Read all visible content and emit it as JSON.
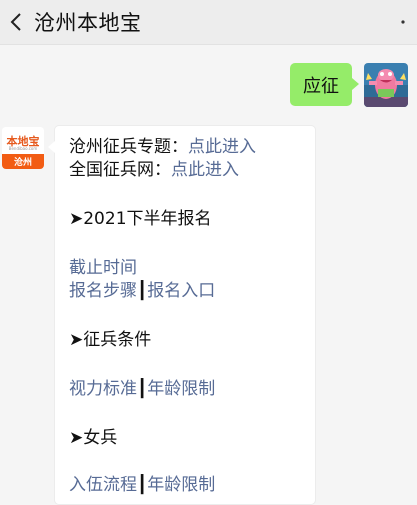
{
  "header": {
    "title": "沧州本地宝",
    "back_icon": "chevron-left-icon",
    "more_icon": "more-dots-icon"
  },
  "outgoing_message": {
    "text": "应征"
  },
  "sender_avatar": {
    "brand_text": "本地宝",
    "url_text": "Bendibao.com",
    "city_text": "沧州"
  },
  "incoming_message": {
    "line1_label": "沧州征兵专题：",
    "line1_link": "点此进入",
    "line2_label": "全国征兵网：",
    "line2_link": "点此进入",
    "section1_heading": "➤2021下半年报名",
    "deadline_link": "截止时间",
    "steps_link": "报名步骤",
    "sep1": "┃",
    "entry_link": "报名入口",
    "section2_heading": "➤征兵条件",
    "vision_link": "视力标准",
    "sep2": "┃",
    "age_link": "年龄限制",
    "section3_heading": "➤女兵",
    "process_link": "入伍流程",
    "sep3": "┃",
    "age_link2": "年龄限制"
  },
  "colors": {
    "outgoing_bubble": "#95ec69",
    "link": "#576b95",
    "brand_orange": "#f25c13"
  }
}
